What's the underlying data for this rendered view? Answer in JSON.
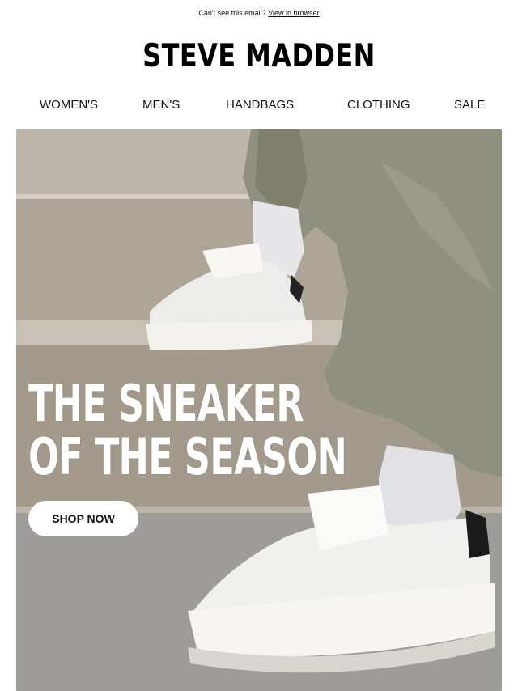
{
  "preheader": {
    "text": "Can't see this email?",
    "link": "View in browser"
  },
  "brand": {
    "logo": "STEVE MADDEN"
  },
  "nav": {
    "items": [
      "WOMEN'S",
      "MEN'S",
      "HANDBAGS",
      "CLOTHING",
      "SALE"
    ]
  },
  "hero": {
    "headline_line1": "THE SNEAKER",
    "headline_line2": "OF THE SEASON",
    "cta": "SHOP NOW",
    "image": "white-platform-sneakers-on-steps-photo"
  },
  "colors": {
    "background": "#ffffff",
    "text": "#111111",
    "headline": "#ffffff",
    "button": "#ffffff"
  }
}
